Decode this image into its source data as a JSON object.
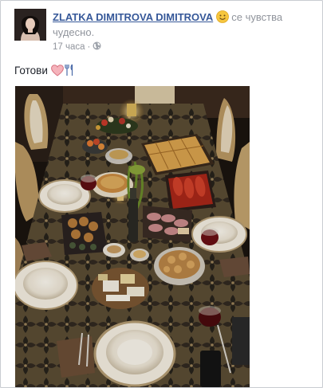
{
  "post": {
    "author": "ZLATKA DIMITROVA DIMITROVA",
    "feeling": "се чувства чудесно.",
    "timestamp": "17 часа",
    "separator": "·",
    "message": "Готови"
  },
  "icons": {
    "feeling": "smiley-icon",
    "privacy": "globe-icon",
    "emoji_1": "heart-icon",
    "emoji_2": "fork-knife-icon"
  },
  "colors": {
    "link": "#365899",
    "meta": "#90949c",
    "text": "#1d2129",
    "heart": "#f0a0a8",
    "smiley": "#f6c63f"
  }
}
